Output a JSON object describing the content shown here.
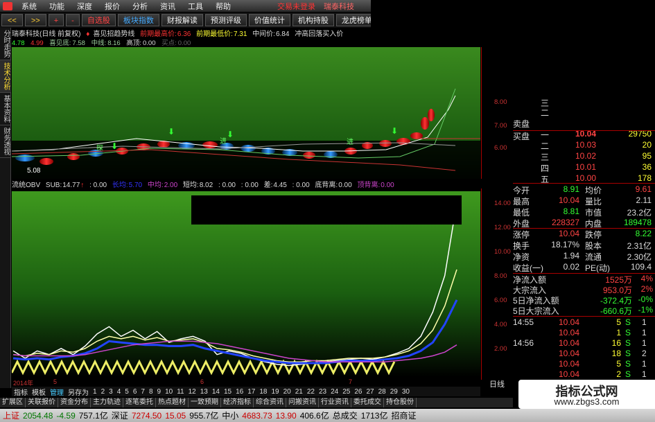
{
  "menu": {
    "items": [
      "系统",
      "功能",
      "深度",
      "报价",
      "分析",
      "资讯",
      "工具",
      "帮助"
    ],
    "warning": "交易未登录",
    "stock_name": "瑞泰科技"
  },
  "toolbar": {
    "buttons": [
      "<<",
      ">>",
      "+",
      "-",
      "自选股",
      "板块指数",
      "财报解读",
      "预测评级",
      "价值统计",
      "机构持股",
      "龙虎榜单"
    ]
  },
  "left_tabs": [
    "分时走势",
    "技术分析",
    "基本资料",
    "财务透视"
  ],
  "kline_title": {
    "name": "瑞泰科技(日线 前复权)",
    "indicator": "喜见招趋势线",
    "cur_high_label": "前期最高价:",
    "cur_high": "6.36",
    "prev_low_label": "前期最低价:",
    "prev_low": "7.31",
    "mid_label": "中间价:",
    "mid": "6.84",
    "extra": "冲高回落买入价"
  },
  "kline_ma": {
    "v1": "4.78",
    "v2": "4.99",
    "v3_label": "喜见底:",
    "v3": "7.58",
    "v4_label": "中线:",
    "v4": "8.16",
    "v5_label": "高顶:",
    "v5": "0.00",
    "v6_label": "买点:",
    "v6": "0.00"
  },
  "kline_annotations": {
    "low_price": "5.08",
    "buy_marker": "探",
    "sell_marker": "进"
  },
  "kline_axis": [
    "8.00",
    "7.00",
    "6.00"
  ],
  "indicator_line": {
    "name": "流统OBV",
    "sub_label": "SUB:",
    "sub": "14.77",
    "v1": ": 0.00",
    "long_label": "长均:",
    "long": "5.70",
    "mid_label": "中均:",
    "mid": "2.00",
    "short_label": "短均:",
    "short": "8.02",
    "v2": ": 0.00",
    "v3": ": 0.00",
    "disc_label": "差:",
    "disc": "4.45",
    "v4": ": 0.00",
    "bottom_label": "底背离:",
    "bottom": "0.00",
    "top_label": "顶背离:",
    "top": "0.00"
  },
  "indicator_axis": [
    "14.00",
    "12.00",
    "10.00",
    "8.00",
    "6.00",
    "4.00",
    "2.00"
  ],
  "chart_data": {
    "type": "line",
    "x": [
      1,
      2,
      3,
      4,
      5,
      6,
      7,
      8,
      9,
      10,
      11,
      12,
      13,
      14,
      15,
      16,
      17,
      18,
      19,
      20,
      21,
      22,
      23,
      24,
      25,
      26,
      27,
      28,
      29,
      30,
      31,
      32,
      33,
      34,
      35,
      36,
      37,
      38,
      39,
      40
    ],
    "series": [
      {
        "color": "#ffffff",
        "values": [
          1.8,
          1.2,
          1.8,
          1.5,
          2.0,
          1.5,
          2.2,
          3.2,
          3.8,
          3.0,
          3.5,
          2.8,
          3.4,
          2.5,
          2.8,
          3.0,
          2.6,
          1.5,
          1.8,
          1.6,
          1.2,
          0.9,
          0.7,
          0.6,
          0.7,
          0.8,
          0.9,
          1.0,
          1.1,
          1.2,
          1.1,
          1.3,
          1.6,
          2.0,
          3.0,
          5.0,
          8.0,
          14.0
        ]
      },
      {
        "color": "#ffffaa",
        "values": [
          1.5,
          1.4,
          1.6,
          1.5,
          1.8,
          1.7,
          2.0,
          2.6,
          3.0,
          2.8,
          3.0,
          2.7,
          2.9,
          2.6,
          2.7,
          2.8,
          2.5,
          2.0,
          1.9,
          1.7,
          1.4,
          1.2,
          1.0,
          0.9,
          0.9,
          1.0,
          1.0,
          1.1,
          1.2,
          1.2,
          1.2,
          1.3,
          1.5,
          1.8,
          2.4,
          3.5,
          5.5,
          8.5
        ]
      },
      {
        "color": "#2244ff",
        "values": [
          1.2,
          1.1,
          1.2,
          1.1,
          1.3,
          1.4,
          1.6,
          2.0,
          2.6,
          2.5,
          2.4,
          2.3,
          2.3,
          2.2,
          2.2,
          2.3,
          2.0,
          1.8,
          1.6,
          1.4,
          1.2,
          1.0,
          0.9,
          0.8,
          0.8,
          0.8,
          0.8,
          0.9,
          1.0,
          1.0,
          1.0,
          1.1,
          1.2,
          1.4,
          1.8,
          2.5,
          4.0,
          6.0
        ]
      },
      {
        "color": "#cc44cc",
        "values": [
          1.5,
          1.4,
          1.4,
          1.4,
          1.4,
          1.4,
          1.5,
          1.7,
          1.9,
          2.1,
          2.3,
          2.4,
          2.5,
          2.6,
          2.6,
          2.6,
          2.5,
          2.4,
          2.2,
          2.0,
          1.8,
          1.6,
          1.4,
          1.2,
          1.1,
          1.0,
          0.9,
          0.9,
          0.9,
          0.9,
          0.9,
          0.9,
          1.0,
          1.1,
          1.2,
          1.4,
          1.7,
          2.3
        ]
      }
    ]
  },
  "date_axis": [
    "2014年",
    "5",
    "6",
    "7"
  ],
  "periods": {
    "labels": [
      "指标",
      "模板",
      "管理",
      "另存为"
    ],
    "numbers": [
      "1",
      "2",
      "3",
      "4",
      "5",
      "6",
      "7",
      "8",
      "9",
      "10",
      "11",
      "12",
      "13",
      "14",
      "15",
      "16",
      "17",
      "18",
      "19",
      "20",
      "21",
      "22",
      "23",
      "24",
      "25",
      "26",
      "27",
      "28",
      "29",
      "30"
    ],
    "day": "日线"
  },
  "bottom_tabs": [
    "扩展区",
    "关联报价",
    "资金分布",
    "主力轨迹",
    "逐笔委托",
    "热点题材",
    "一致预期",
    "经济指标",
    "综合资讯",
    "问搬资讯",
    "行业资讯",
    "委托成交",
    "持仓股份"
  ],
  "status_bar": {
    "sh_label": "上证",
    "sh": "2054.48",
    "sh_chg": "-4.59",
    "sh_vol": "757.1亿",
    "sz_label": "深证",
    "sz": "7274.50",
    "sz_chg": "15.05",
    "sz_vol": "955.7亿",
    "zx_label": "中小",
    "zx": "4683.73",
    "zx_chg": "13.90",
    "zx_vol": "406.6亿",
    "total_label": "总成交",
    "total": "1713亿",
    "broker": "招商证"
  },
  "quote": {
    "sell_label": "卖盘",
    "buy_label": "买盘",
    "sell_levels": [
      "三",
      "二",
      "一"
    ],
    "sell_prices": [
      "",
      "",
      "10.04"
    ],
    "sell_vols": [
      "",
      "",
      "29750"
    ],
    "buy_levels": [
      "二",
      "三",
      "四",
      "五"
    ],
    "buy_prices": [
      "10.03",
      "10.02",
      "10.01",
      "10.00"
    ],
    "buy_vols": [
      "20",
      "95",
      "36",
      "178"
    ],
    "stats": [
      {
        "l1": "今开",
        "v1": "8.91",
        "l2": "均价",
        "v2": "9.61"
      },
      {
        "l1": "最高",
        "v1": "10.04",
        "l2": "量比",
        "v2": "2.11"
      },
      {
        "l1": "最低",
        "v1": "8.81",
        "l2": "市值",
        "v2": "23.2亿"
      },
      {
        "l1": "外盘",
        "v1": "228327",
        "l2": "内盘",
        "v2": "189478"
      },
      {
        "l1": "涨停",
        "v1": "10.04",
        "l2": "跌停",
        "v2": "8.22"
      },
      {
        "l1": "换手",
        "v1": "18.17%",
        "l2": "股本",
        "v2": "2.31亿"
      },
      {
        "l1": "净资",
        "v1": "1.94",
        "l2": "流通",
        "v2": "2.30亿"
      },
      {
        "l1": "收益(一)",
        "v1": "0.02",
        "l2": "PE(动)",
        "v2": "109.4"
      }
    ],
    "flows": [
      {
        "label": "净流入额",
        "value": "1525万",
        "pct": "4%"
      },
      {
        "label": "大宗流入",
        "value": "953.0万",
        "pct": "2%"
      },
      {
        "label": "5日净流入额",
        "value": "-372.4万",
        "pct": "-0%"
      },
      {
        "label": "5日大宗流入",
        "value": "-660.6万",
        "pct": "-1%"
      }
    ],
    "ticks": [
      {
        "time": "14:55",
        "price": "10.04",
        "vol": "5",
        "side": "S",
        "num": "1"
      },
      {
        "time": "",
        "price": "10.04",
        "vol": "1",
        "side": "S",
        "num": "1"
      },
      {
        "time": "14:56",
        "price": "10.04",
        "vol": "16",
        "side": "S",
        "num": "1"
      },
      {
        "time": "",
        "price": "10.04",
        "vol": "18",
        "side": "S",
        "num": "2"
      },
      {
        "time": "",
        "price": "10.04",
        "vol": "5",
        "side": "S",
        "num": "1"
      },
      {
        "time": "",
        "price": "10.04",
        "vol": "2",
        "side": "S",
        "num": "1"
      }
    ]
  },
  "watermark": {
    "title": "指标公式网",
    "url": "www.zbgs3.com"
  }
}
